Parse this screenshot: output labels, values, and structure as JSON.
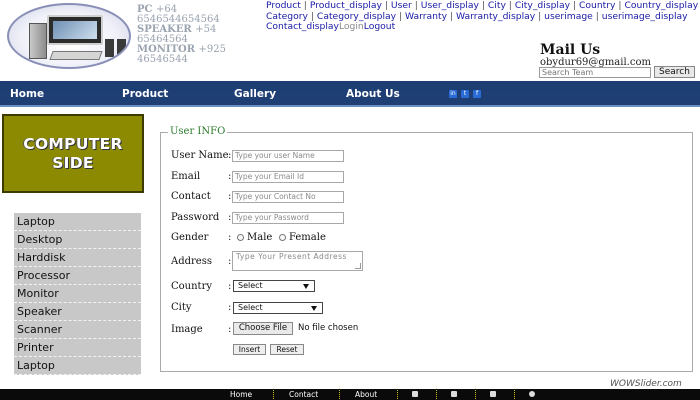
{
  "header": {
    "contact": {
      "pc_label": "PC",
      "pc_number": "+64 6546544654564",
      "speaker_label": "SPEAKER",
      "speaker_number": "+54 65464564",
      "monitor_label": "MONITOR",
      "monitor_number": "+925 46546544"
    },
    "top_links": [
      "Product",
      "Product_display",
      "User",
      "User_display",
      "City",
      "City_display",
      "Country",
      "Country_display",
      "Category",
      "Category_display",
      "Warranty",
      "Warranty_display",
      "userimage",
      "userimage_display",
      "Contact_display"
    ],
    "login": "Login",
    "logout": "Logout",
    "mail_title": "Mail Us",
    "mail_email": "obydur69@gmail.com",
    "search_placeholder": "Search Team",
    "search_button": "Search"
  },
  "nav": {
    "items": [
      "Home",
      "Product",
      "Gallery",
      "About Us"
    ],
    "social_icons": [
      "linkedin-icon",
      "twitter-icon",
      "facebook-icon"
    ]
  },
  "sidebar": {
    "brand_line1": "COMPUTER",
    "brand_line2": "SIDE",
    "categories": [
      "Laptop",
      "Desktop",
      "Harddisk",
      "Processor",
      "Monitor",
      "Speaker",
      "Scanner",
      "Printer",
      "Laptop"
    ]
  },
  "form": {
    "legend": "User INFO",
    "labels": {
      "username": "User Name",
      "email": "Email",
      "contact": "Contact",
      "password": "Password",
      "gender": "Gender",
      "address": "Address",
      "country": "Country",
      "city": "City",
      "image": "Image"
    },
    "colon": ":",
    "placeholders": {
      "username": "Type your user Name",
      "email": "Type your Email Id",
      "contact": "Type your Contact No",
      "password": "Type your Password",
      "address": "Type Your Present Address"
    },
    "gender_options": [
      "Male",
      "Female"
    ],
    "country_selected": "Select",
    "city_selected": "Select",
    "file_button": "Choose File",
    "file_status": "No file chosen",
    "insert_button": "Insert",
    "reset_button": "Reset"
  },
  "footer": {
    "items": [
      "Home",
      "Contact",
      "About"
    ],
    "icons": [
      "facebook-icon",
      "twitter-icon",
      "linkedin-icon",
      "chat-icon"
    ]
  },
  "watermark": "WOWSlider.com",
  "colors": {
    "nav_bg": "#1c3d73",
    "brand_bg": "#8c8a00",
    "sidebar_item_bg": "#c8c8c8",
    "link_color": "#1a1aa6",
    "legend_color": "#2c7a2c"
  }
}
